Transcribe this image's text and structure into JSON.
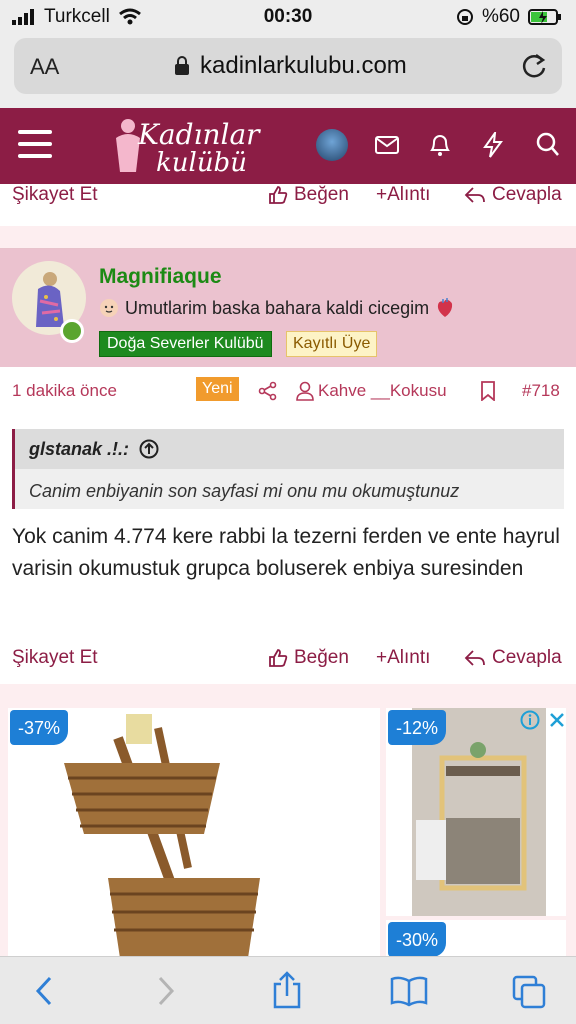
{
  "status_bar": {
    "carrier": "Turkcell",
    "time": "00:30",
    "battery": "%60"
  },
  "browser": {
    "text_size_label": "AA",
    "url": "kadinlarkulubu.com"
  },
  "site": {
    "logo_line1": "Kadınlar",
    "logo_line2": "kulübü",
    "brand_color": "#8c1d45"
  },
  "top_actions": {
    "report": "Şikayet Et",
    "like": "Beğen",
    "quote": "+Alıntı",
    "reply": "Cevapla"
  },
  "post": {
    "username": "Magnifiaque",
    "status": "Umutlarim baska bahara kaldi cicegim",
    "group_badge": "Doğa Severler Kulübü",
    "role_badge": "Kayıtlı Üye",
    "time_ago": "1 dakika önce",
    "new_badge": "Yeni",
    "mention_user": "Kahve __Kokusu",
    "post_number": "#718",
    "quote_author": "glstanak .!.:",
    "quote_text": "Canim enbiyanin son sayfasi mi onu mu okumuştunuz",
    "body": "Yok canim 4.774 kere rabbi la tezerni ferden ve ente hayrul varisin okumustuk grupca boluserek enbiya suresinden",
    "actions": {
      "report": "Şikayet Et",
      "like": "Beğen",
      "quote": "+Alıntı",
      "reply": "Cevapla"
    }
  },
  "ads": {
    "discount1": "-37%",
    "discount2": "-12%",
    "discount3": "-30%"
  }
}
